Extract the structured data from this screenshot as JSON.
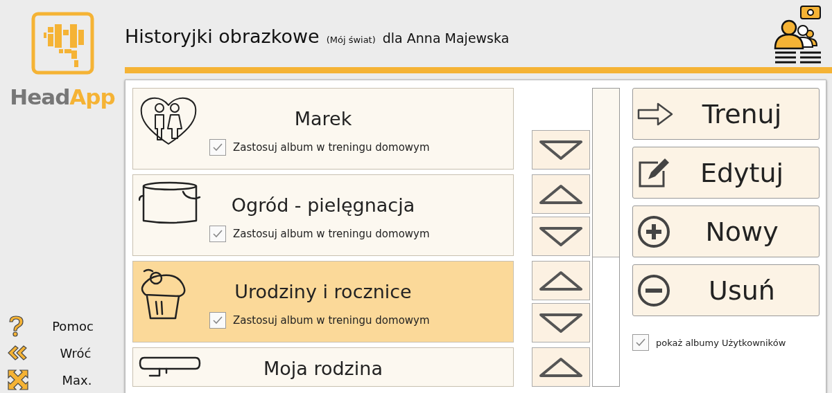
{
  "logo": {
    "text_parts": [
      "Head",
      "App"
    ]
  },
  "header": {
    "title": "Historyjki obrazkowe",
    "subtitle": "(Mój świat)",
    "user": "dla Anna Majewska"
  },
  "nav": [
    {
      "label": "Pomoc"
    },
    {
      "label": "Wróć"
    },
    {
      "label": "Max."
    }
  ],
  "albums": [
    {
      "title": "Marek",
      "selected": false,
      "home_training": {
        "label": "Zastosuj album w treningu domowym",
        "checked": true
      },
      "move_up": false,
      "move_down": true
    },
    {
      "title": "Ogród - pielęgnacja",
      "selected": false,
      "home_training": {
        "label": "Zastosuj album w treningu domowym",
        "checked": true
      },
      "move_up": true,
      "move_down": true
    },
    {
      "title": "Urodziny i rocznice",
      "selected": true,
      "home_training": {
        "label": "Zastosuj album w treningu domowym",
        "checked": true
      },
      "move_up": true,
      "move_down": true
    },
    {
      "title": "Moja rodzina",
      "selected": false,
      "move_up": true,
      "move_down": false
    }
  ],
  "actions": [
    {
      "label": "Trenuj"
    },
    {
      "label": "Edytuj"
    },
    {
      "label": "Nowy"
    },
    {
      "label": "Usuń"
    }
  ],
  "show_user_albums": {
    "label": "pokaż albumy Użytkowników",
    "checked": true
  }
}
